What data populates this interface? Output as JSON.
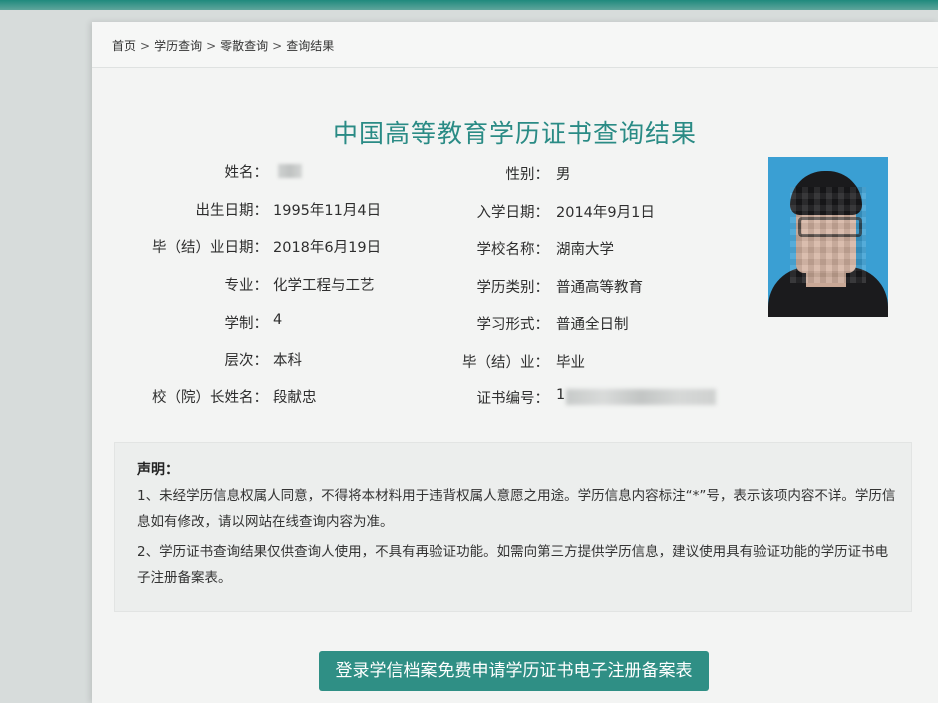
{
  "breadcrumb": {
    "items": [
      "首页",
      "学历查询",
      "零散查询",
      "查询结果"
    ],
    "separator": ">"
  },
  "title": "中国高等教育学历证书查询结果",
  "left_fields": [
    {
      "label": "姓名：",
      "value": ""
    },
    {
      "label": "出生日期：",
      "value": "1995年11月4日"
    },
    {
      "label": "毕（结）业日期：",
      "value": "2018年6月19日"
    },
    {
      "label": "专业：",
      "value": "化学工程与工艺"
    },
    {
      "label": "学制：",
      "value": "4"
    },
    {
      "label": "层次：",
      "value": "本科"
    },
    {
      "label": "校（院）长姓名：",
      "value": "段献忠"
    }
  ],
  "right_fields": [
    {
      "label": "性别：",
      "value": "男"
    },
    {
      "label": "入学日期：",
      "value": "2014年9月1日"
    },
    {
      "label": "学校名称：",
      "value": "湖南大学"
    },
    {
      "label": "学历类别：",
      "value": "普通高等教育"
    },
    {
      "label": "学习形式：",
      "value": "普通全日制"
    },
    {
      "label": "毕（结）业：",
      "value": "毕业"
    },
    {
      "label": "证书编号：",
      "value": "1"
    }
  ],
  "notice": {
    "heading": "声明：",
    "lines": [
      "1、未经学历信息权属人同意，不得将本材料用于违背权属人意愿之用途。学历信息内容标注“*”号，表示该项内容不详。学历信息如有修改，请以网站在线查询内容为准。",
      "2、学历证书查询结果仅供查询人使用，不具有再验证功能。如需向第三方提供学历信息，建议使用具有验证功能的学历证书电子注册备案表。"
    ]
  },
  "action_button": {
    "label": "登录学信档案免费申请学历证书电子注册备案表"
  },
  "colors": {
    "title": "#2a8b85",
    "button": "#2f8f85",
    "photo_bg": "#3a9fd3"
  }
}
